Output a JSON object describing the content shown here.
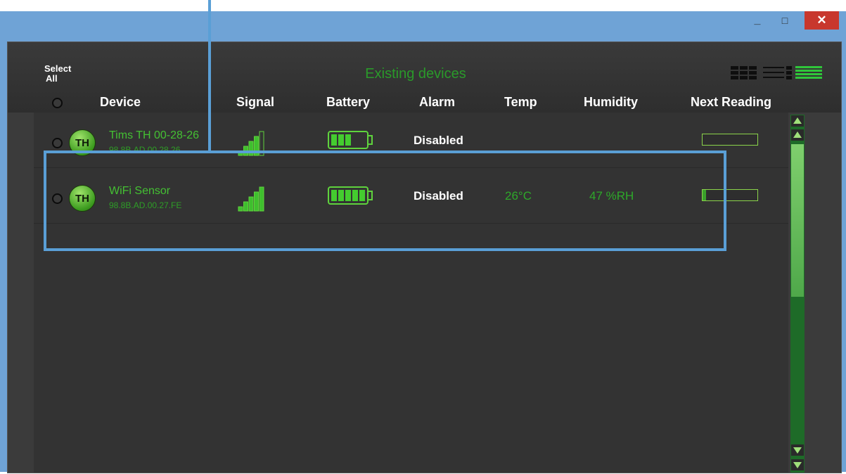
{
  "window": {
    "min_label": "_",
    "max_label": "□",
    "close_label": "✕"
  },
  "header": {
    "select_all_line1": "Select",
    "select_all_line2": "All",
    "title": "Existing devices",
    "columns": {
      "device": "Device",
      "signal": "Signal",
      "battery": "Battery",
      "alarm": "Alarm",
      "temp": "Temp",
      "humidity": "Humidity",
      "next_reading": "Next Reading"
    },
    "view_icons": [
      "grid-view-icon",
      "list-view-icon",
      "compact-list-view-icon"
    ]
  },
  "devices": [
    {
      "avatar": "TH",
      "name": "Tims TH 00-28-26",
      "id": "98.8B.AD.00.28.26",
      "signal_bars": 4,
      "battery_fraction": 0.5,
      "alarm": "Disabled",
      "temp": "",
      "humidity": "",
      "next_reading_fraction": 0.0
    },
    {
      "avatar": "TH",
      "name": "WiFi Sensor",
      "id": "98.8B.AD.00.27.FE",
      "signal_bars": 5,
      "battery_fraction": 1.0,
      "alarm": "Disabled",
      "temp": "26°C",
      "humidity": "47 %RH",
      "next_reading_fraction": 0.07
    }
  ],
  "colors": {
    "accent_green": "#3aa02b",
    "highlight_blue": "#5a9fd6",
    "close_red": "#c8372d"
  }
}
